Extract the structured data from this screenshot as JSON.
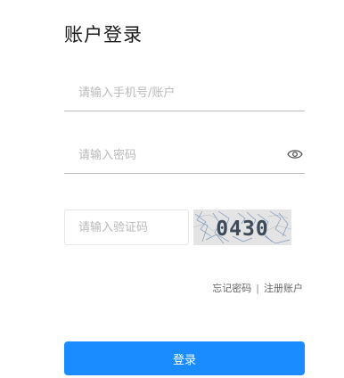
{
  "login": {
    "title": "账户登录",
    "account_placeholder": "请输入手机号/账户",
    "password_placeholder": "请输入密码",
    "captcha_placeholder": "请输入验证码",
    "captcha_code": "0430",
    "forgot_password": "忘记密码",
    "separator": "|",
    "register": "注册账户",
    "submit_label": "登录"
  },
  "icons": {
    "password_toggle": "eye-icon"
  },
  "colors": {
    "primary_button": "#1a8cff",
    "field_underline": "#bcbcbc",
    "placeholder": "#b9b9b9",
    "link_text": "#666666"
  }
}
